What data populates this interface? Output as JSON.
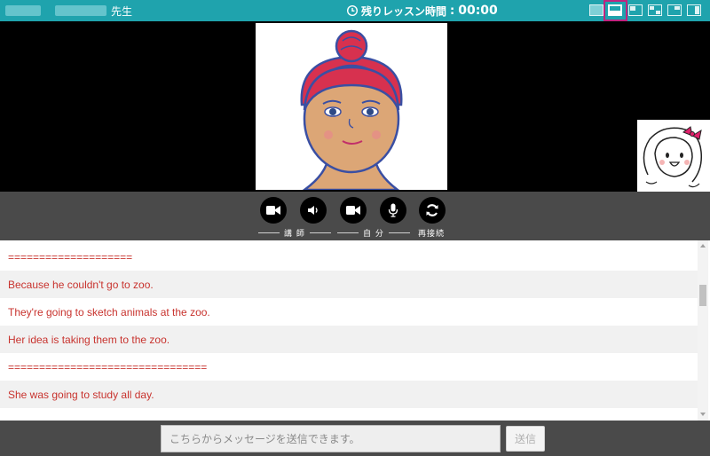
{
  "header": {
    "teacher_suffix": "先生",
    "timer_label": "残りレッスン時間",
    "timer_separator": ":",
    "timer_value": "00:00",
    "icons": [
      "clock-icon",
      "layout-icon"
    ],
    "layout_options": [
      "layout-1",
      "layout-2",
      "layout-3",
      "layout-4",
      "layout-5",
      "layout-6"
    ],
    "selected_layout_index": 1,
    "bar_color": "#1fa3ad",
    "highlight_color": "#c0237f"
  },
  "controls": {
    "teacher_label": "講 師",
    "self_label": "自 分",
    "reconnect_label": "再接続",
    "icons": [
      "video-camera-icon",
      "speaker-icon",
      "video-camera-icon",
      "microphone-icon",
      "refresh-icon"
    ]
  },
  "chat": {
    "messages": [
      "====================",
      "Because he couldn't go to zoo.",
      "They're going to sketch animals at the zoo.",
      "Her idea is taking them to the zoo.",
      "================================",
      "She was going to study all day."
    ],
    "text_color": "#c8332e"
  },
  "input": {
    "placeholder": "こちらからメッセージを送信できます。",
    "value": "",
    "send_label": "送信"
  }
}
